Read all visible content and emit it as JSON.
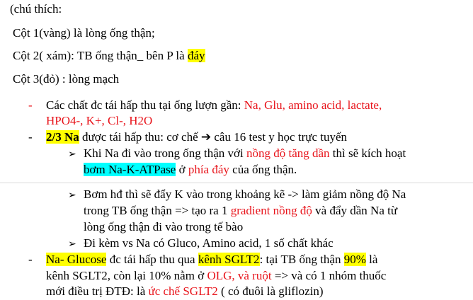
{
  "intro": "(chú thích:",
  "col1": "Cột 1(vàng) là lòng ống thận;",
  "col2": {
    "prefix": "Cột 2( xám): TB ống thận_ bên P là ",
    "highlight": "đáy"
  },
  "col3": "Cột 3(đỏ) : lòng mạch",
  "bullet_marker": "-",
  "arrow_marker": "➢",
  "item1": {
    "text": "Các chất đc tái hấp thu tại ống lượn gần: ",
    "red1": "Na, Glu, amino acid, lactate,",
    "red2": "HPO4-, K+, Cl-, H2O"
  },
  "item2": {
    "bold": "2/3 Na",
    "text": " được tái hấp thu: cơ chế ",
    "arrow_icon": "➔",
    "text2": " câu 16 test y học trực tuyến"
  },
  "sub1": {
    "a": "Khi Na đi vào trong ống thận với ",
    "red": "nồng độ tăng dần",
    "b": " thì sẽ kích hoạt",
    "cyan": "bơm Na-K-ATPase",
    "c": " ở ",
    "red2": "phía đáy",
    "d": " của ống thận."
  },
  "sub2": {
    "line1": "Bơm hđ thì sẽ đẩy K vào trong khoảng kẽ -> làm giảm nồng độ Na",
    "a": "trong TB ống thận => tạo ra 1 ",
    "red": "gradient nồng độ",
    "b": " và đẩy dần Na từ",
    "line3": "lòng ống thận đi vào trong tế bào"
  },
  "sub3": "Đi kèm vs Na có Gluco, Amino acid, 1 số chất khác",
  "item3": {
    "hl1": "Na- Glucose",
    "a": " đc tái hấp thu qua ",
    "hl2": "kênh SGLT2",
    "b": ": tại TB ống thận ",
    "hl3": "90%",
    "c": " là",
    "d": "kênh SGLT2, còn lại 10% nằm ở ",
    "red": "OLG, và ruột",
    "e": " => và có 1 nhóm thuốc",
    "f": "mới điều trị ĐTĐ: là ",
    "red2": "ức chế SGLT2",
    "g": " ( có đuôi là gliflozin)"
  }
}
